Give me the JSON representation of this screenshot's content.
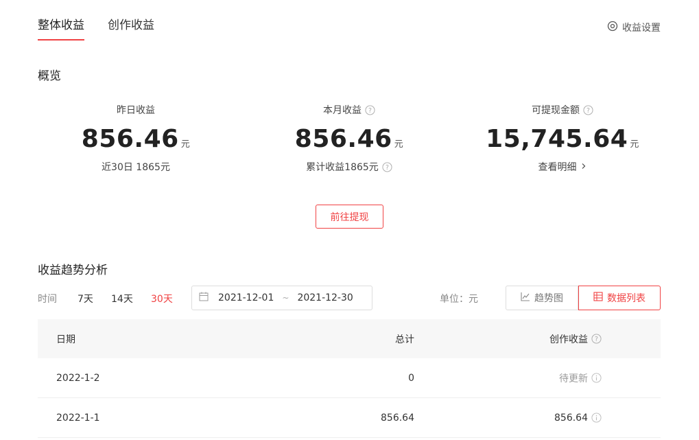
{
  "tabs": [
    {
      "label": "整体收益",
      "active": true
    },
    {
      "label": "创作收益",
      "active": false
    }
  ],
  "settings_label": "收益设置",
  "overview": {
    "title": "概览",
    "yesterday": {
      "label": "昨日收益",
      "value": "856.46",
      "unit": "元",
      "sub": "近30日 1865元"
    },
    "month": {
      "label": "本月收益",
      "value": "856.46",
      "unit": "元",
      "sub": "累计收益1865元"
    },
    "withdrawable": {
      "label": "可提现金额",
      "value": "15,745.64",
      "unit": "元",
      "sub": "查看明细"
    }
  },
  "withdraw_button": "前往提现",
  "trend": {
    "title": "收益趋势分析",
    "time_label": "时间",
    "ranges": [
      "7天",
      "14天",
      "30天"
    ],
    "active_range": "30天",
    "date_start": "2021-12-01",
    "date_sep": "~",
    "date_end": "2021-12-30",
    "unit_label": "单位：元",
    "view_chart": "趋势图",
    "view_table": "数据列表"
  },
  "table": {
    "headers": [
      "日期",
      "总计",
      "创作收益"
    ],
    "rows": [
      {
        "date": "2022-1-2",
        "total": "0",
        "creation": "待更新"
      },
      {
        "date": "2022-1-1",
        "total": "856.64",
        "creation": "856.64"
      }
    ]
  },
  "colors": {
    "accent": "#f04142"
  }
}
